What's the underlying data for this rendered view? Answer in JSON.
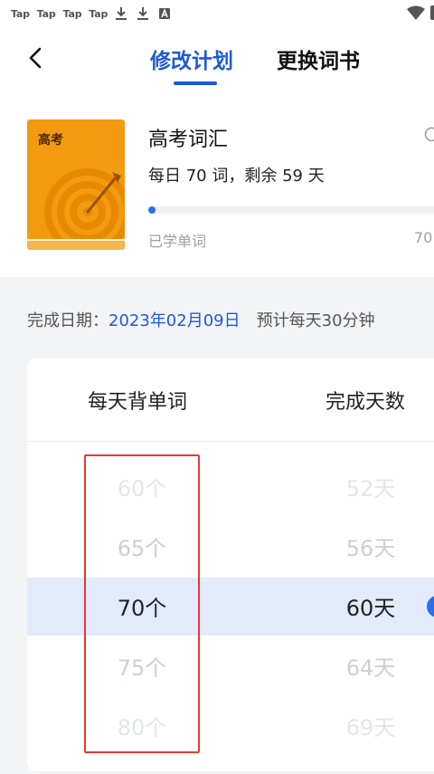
{
  "statusbar": {
    "tap_items": [
      "Tap",
      "Tap",
      "Tap",
      "Tap"
    ],
    "icons": [
      "download-icon",
      "download-icon",
      "notification-a-icon",
      "wifi-icon",
      "battery-icon"
    ]
  },
  "header": {
    "tabs": [
      {
        "label": "修改计划",
        "active": true
      },
      {
        "label": "更换词书",
        "active": false
      }
    ]
  },
  "book": {
    "cover_label": "高考",
    "title": "高考词汇",
    "plan_text": "每日 70 词，剩余 59 天",
    "progress_fraction": 0.01,
    "learned_label": "已学单词",
    "learned_total": "70"
  },
  "finish": {
    "label": "完成日期：",
    "date": "2023年02月09日",
    "estimate": "预计每天30分钟"
  },
  "picker": {
    "left_header": "每天背单词",
    "right_header": "完成天数",
    "left_options": [
      "60个",
      "65个",
      "70个",
      "75个",
      "80个"
    ],
    "right_options": [
      "52天",
      "56天",
      "60天",
      "64天",
      "69天"
    ],
    "selected_index": 2
  },
  "colors": {
    "accent": "#1c5ad6",
    "selection_band": "#e1ebfc",
    "cover_orange": "#f39a10",
    "highlight_box": "#e53935"
  }
}
